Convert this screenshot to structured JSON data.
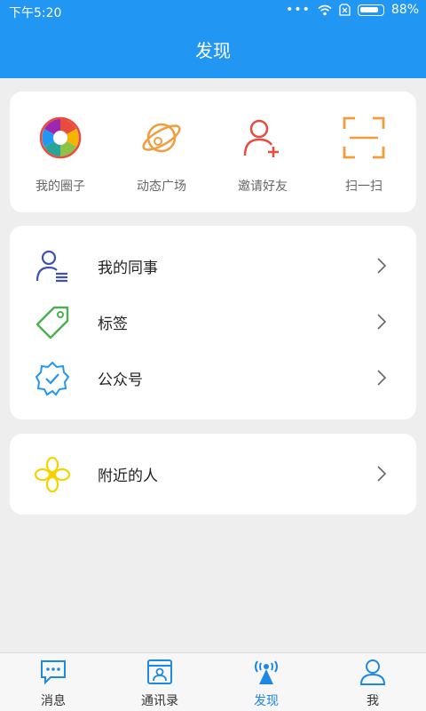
{
  "status_bar": {
    "time": "下午5:20",
    "dots": "•••",
    "battery": "88%",
    "battery_level": 0.88
  },
  "header": {
    "title": "发现"
  },
  "quick_actions": [
    {
      "label": "我的圈子",
      "icon": "aperture-icon"
    },
    {
      "label": "动态广场",
      "icon": "planet-icon"
    },
    {
      "label": "邀请好友",
      "icon": "add-user-icon"
    },
    {
      "label": "扫一扫",
      "icon": "scan-icon"
    }
  ],
  "list_main": [
    {
      "label": "我的同事",
      "icon": "colleague-icon"
    },
    {
      "label": "标签",
      "icon": "tag-icon"
    },
    {
      "label": "公众号",
      "icon": "verified-badge-icon"
    }
  ],
  "list_nearby": [
    {
      "label": "附近的人",
      "icon": "flower-icon"
    }
  ],
  "tabbar": {
    "active": 2,
    "tabs": [
      {
        "label": "消息",
        "icon": "chat-icon"
      },
      {
        "label": "通讯录",
        "icon": "contacts-icon"
      },
      {
        "label": "发现",
        "icon": "radar-icon"
      },
      {
        "label": "我",
        "icon": "user-icon"
      }
    ]
  },
  "colors": {
    "primary": "#2196f3",
    "tab_active": "#1e88e5",
    "background": "#eeeeee"
  }
}
